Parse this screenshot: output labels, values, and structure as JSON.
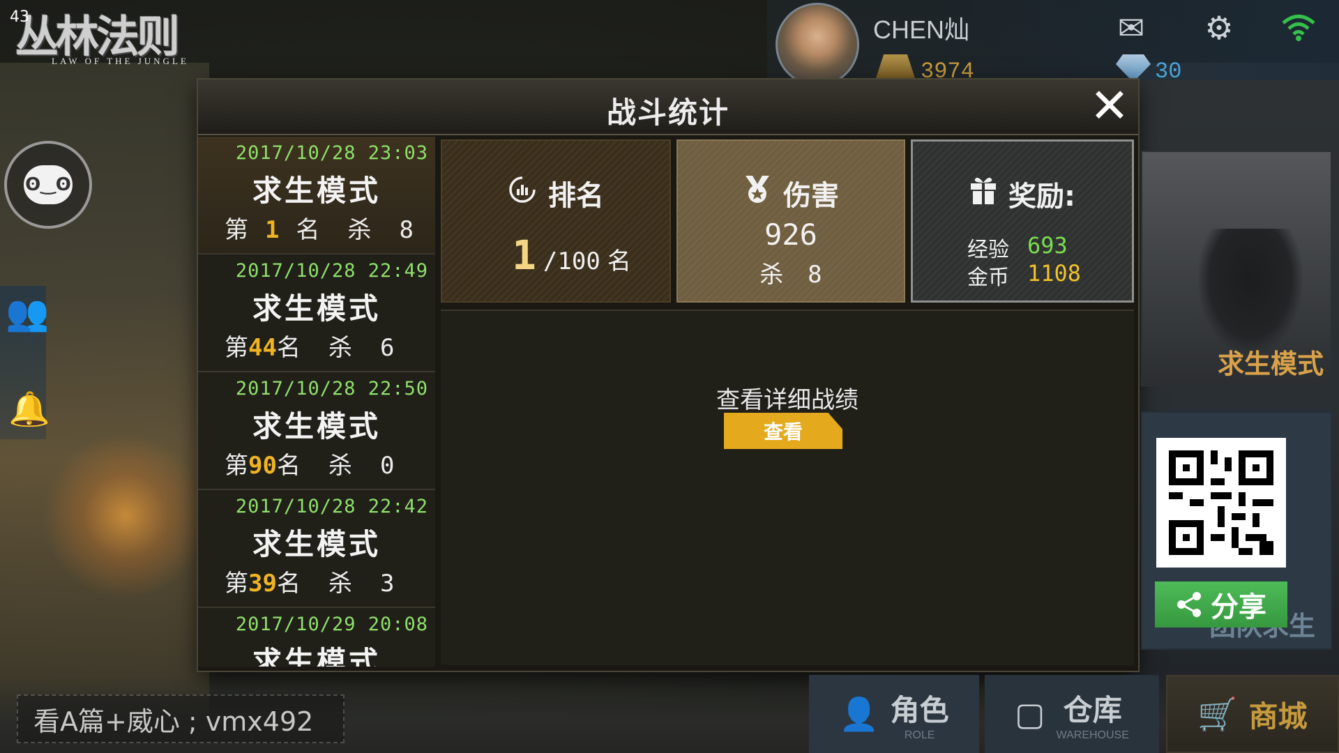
{
  "hud": {
    "fps": "43",
    "logo_title": "丛林法则",
    "logo_subtitle": "LAW OF THE JUNGLE",
    "player_name": "CHEN灿",
    "gold": "3974",
    "gems": "30",
    "icons": [
      "mail-icon",
      "gear-icon",
      "wifi-icon",
      "chat-icon",
      "friends-icon",
      "alert-icon"
    ]
  },
  "dialog": {
    "title": "战斗统计",
    "close_label": "✕"
  },
  "records": [
    {
      "time": "2017/10/28 23:03",
      "mode": "求生模式",
      "rank_prefix": "第",
      "rank": "1",
      "rank_suffix": "名",
      "kill_label": "杀",
      "kills": "8"
    },
    {
      "time": "2017/10/28 22:49",
      "mode": "求生模式",
      "rank_prefix": "第",
      "rank": "44",
      "rank_suffix": "名",
      "kill_label": "杀",
      "kills": "6"
    },
    {
      "time": "2017/10/28 22:50",
      "mode": "求生模式",
      "rank_prefix": "第",
      "rank": "90",
      "rank_suffix": "名",
      "kill_label": "杀",
      "kills": "0"
    },
    {
      "time": "2017/10/28 22:42",
      "mode": "求生模式",
      "rank_prefix": "第",
      "rank": "39",
      "rank_suffix": "名",
      "kill_label": "杀",
      "kills": "3"
    },
    {
      "time": "2017/10/29 20:08",
      "mode": "求生模式"
    }
  ],
  "stats": {
    "rank": {
      "label": "排名",
      "value": "1",
      "total": "/100",
      "unit": "名"
    },
    "damage": {
      "label": "伤害",
      "value": "926",
      "kill_label": "杀",
      "kills": "8"
    },
    "reward": {
      "label": "奖励:",
      "exp_label": "经验",
      "exp": "693",
      "gold_label": "金币",
      "gold": "1108"
    }
  },
  "detail": {
    "label": "查看详细战绩",
    "button": "查看"
  },
  "side": {
    "mode_label": "求生模式",
    "team_label": "团队求生",
    "share_label": "分享"
  },
  "chat_input": {
    "text": "看A篇+威心 ;  vmx492"
  },
  "tabs": [
    {
      "label": "角色",
      "sub": "ROLE"
    },
    {
      "label": "仓库",
      "sub": "WAREHOUSE"
    },
    {
      "label": "商城",
      "sub": ""
    }
  ],
  "colors": {
    "highlight": "#f0b422",
    "time_green": "#8fe06b",
    "exp_green": "#78e04e",
    "gold_yellow": "#f0c22a",
    "view_button": "#e4a91d",
    "share_button": "#4dbb58"
  }
}
